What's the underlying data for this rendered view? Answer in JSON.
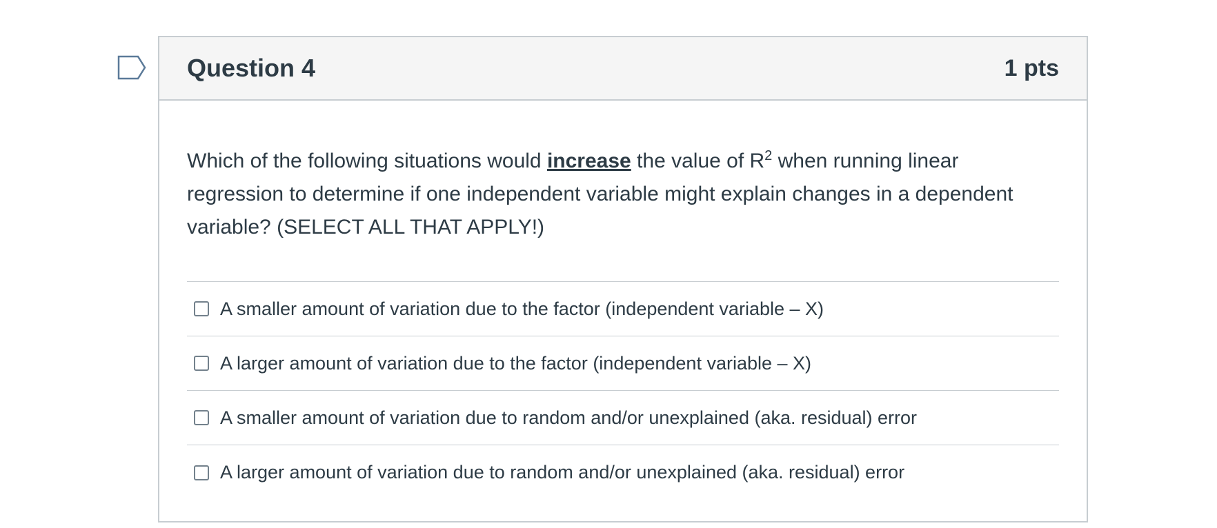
{
  "question": {
    "title": "Question 4",
    "points": "1 pts",
    "text_before": "Which of the following situations would ",
    "text_emphasis": "increase",
    "text_middle": " the value of R",
    "text_superscript": "2",
    "text_after": " when running linear regression to determine if one independent variable might explain changes in a dependent variable? (SELECT ALL THAT APPLY!)"
  },
  "answers": [
    {
      "label": "A smaller amount of variation due to the factor (independent variable – X)",
      "checked": false
    },
    {
      "label": "A larger amount of variation due to the factor (independent variable – X)",
      "checked": false
    },
    {
      "label": "A smaller amount of variation due to random and/or unexplained (aka. residual) error",
      "checked": false
    },
    {
      "label": "A larger amount of variation due to random and/or unexplained (aka. residual) error",
      "checked": false
    }
  ],
  "icons": {
    "flag": "flag-question-icon"
  },
  "colors": {
    "text": "#2d3b45",
    "border": "#c7cdd1",
    "header_bg": "#f5f5f5",
    "flag_stroke": "#5b7a99"
  }
}
